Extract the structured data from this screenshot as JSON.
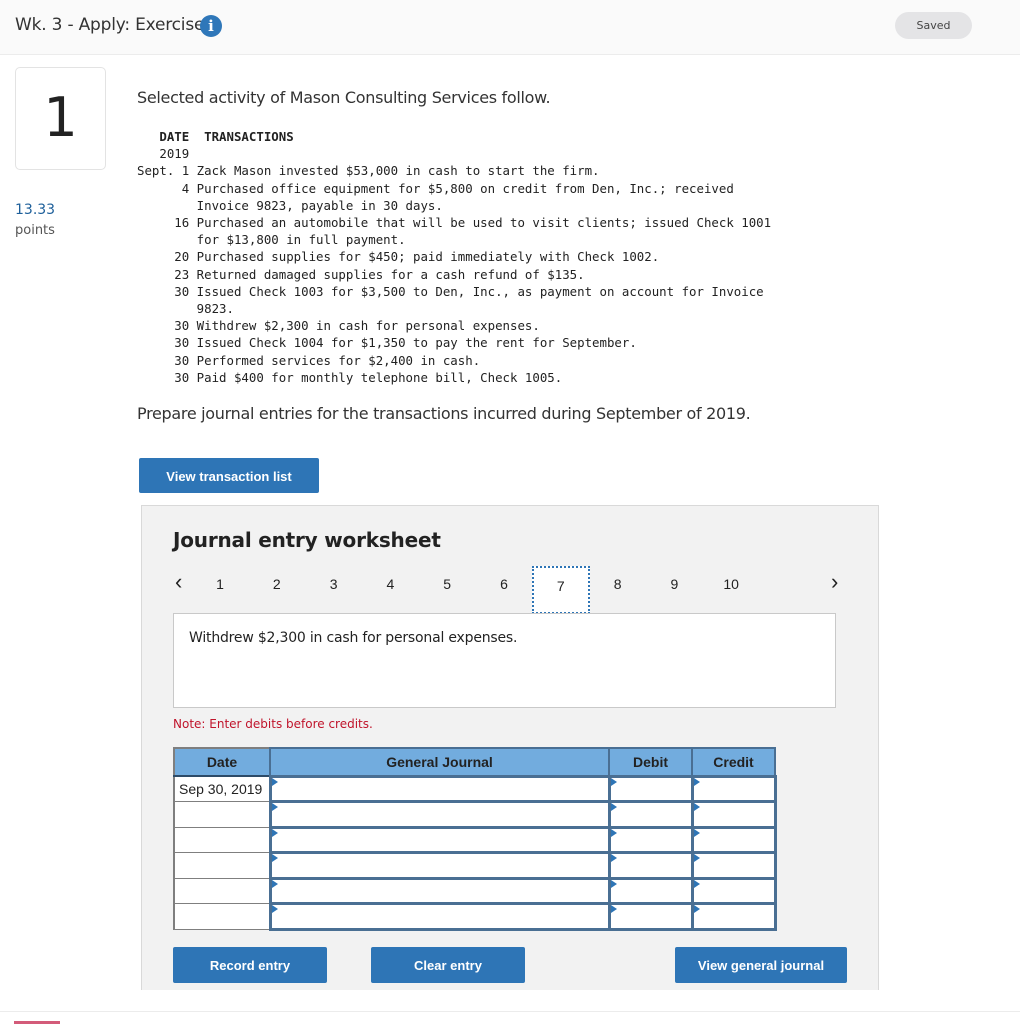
{
  "header": {
    "title": "Wk. 3 - Apply: Exercise",
    "info_icon": "info-icon",
    "save_status": "Saved"
  },
  "question": {
    "number": "1",
    "points_value": "13.33",
    "points_label": "points",
    "intro": "Selected activity of Mason Consulting Services follow.",
    "table_header_date": "DATE",
    "table_header_transactions": "TRANSACTIONS",
    "year": "2019",
    "transactions": [
      {
        "date": "Sept. 1",
        "lines": [
          "Zack Mason invested $53,000 in cash to start the firm."
        ]
      },
      {
        "date": "4",
        "lines": [
          "Purchased office equipment for $5,800 on credit from Den, Inc.; received",
          "Invoice 9823, payable in 30 days."
        ]
      },
      {
        "date": "16",
        "lines": [
          "Purchased an automobile that will be used to visit clients; issued Check 1001",
          "for $13,800 in full payment."
        ]
      },
      {
        "date": "20",
        "lines": [
          "Purchased supplies for $450; paid immediately with Check 1002."
        ]
      },
      {
        "date": "23",
        "lines": [
          "Returned damaged supplies for a cash refund of $135."
        ]
      },
      {
        "date": "30",
        "lines": [
          "Issued Check 1003 for $3,500 to Den, Inc., as payment on account for Invoice",
          "9823."
        ]
      },
      {
        "date": "30",
        "lines": [
          "Withdrew $2,300 in cash for personal expenses."
        ]
      },
      {
        "date": "30",
        "lines": [
          "Issued Check 1004 for $1,350 to pay the rent for September."
        ]
      },
      {
        "date": "30",
        "lines": [
          "Performed services for $2,400 in cash."
        ]
      },
      {
        "date": "30",
        "lines": [
          "Paid $400 for monthly telephone bill, Check 1005."
        ]
      }
    ],
    "instruction": "Prepare journal entries for the transactions incurred during September of 2019.",
    "view_transaction_list_label": "View transaction list"
  },
  "worksheet": {
    "title": "Journal entry worksheet",
    "prev_icon": "chevron-left-icon",
    "next_icon": "chevron-right-icon",
    "pages": [
      "1",
      "2",
      "3",
      "4",
      "5",
      "6",
      "7",
      "8",
      "9",
      "10"
    ],
    "active_page": "7",
    "description": "Withdrew $2,300 in cash for personal expenses.",
    "note": "Note: Enter debits before credits.",
    "columns": [
      "Date",
      "General Journal",
      "Debit",
      "Credit"
    ],
    "rows": [
      {
        "date": "Sep 30, 2019",
        "account": "",
        "debit": "",
        "credit": ""
      },
      {
        "date": "",
        "account": "",
        "debit": "",
        "credit": ""
      },
      {
        "date": "",
        "account": "",
        "debit": "",
        "credit": ""
      },
      {
        "date": "",
        "account": "",
        "debit": "",
        "credit": ""
      },
      {
        "date": "",
        "account": "",
        "debit": "",
        "credit": ""
      },
      {
        "date": "",
        "account": "",
        "debit": "",
        "credit": ""
      }
    ],
    "record_entry_label": "Record entry",
    "clear_entry_label": "Clear entry",
    "view_general_journal_label": "View general journal"
  }
}
